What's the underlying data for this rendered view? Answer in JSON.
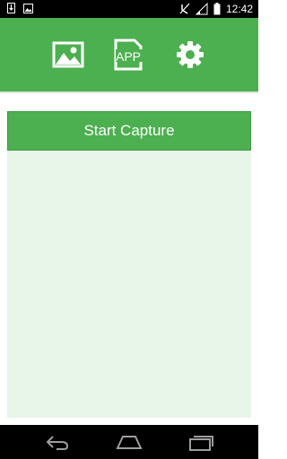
{
  "status_bar": {
    "time": "12:42",
    "icons": [
      "download-icon",
      "image-icon",
      "signal-muted-icon",
      "cellular-icon",
      "battery-icon"
    ]
  },
  "toolbar": {
    "background": "#4caf50",
    "icons": [
      "gallery-icon",
      "app-icon",
      "settings-icon"
    ],
    "app_icon_text": "APP"
  },
  "capture": {
    "button_label": "Start Capture",
    "panel_background": "#e8f5e9"
  },
  "nav_bar": {
    "buttons": [
      "back-icon",
      "home-icon",
      "recents-icon"
    ]
  }
}
